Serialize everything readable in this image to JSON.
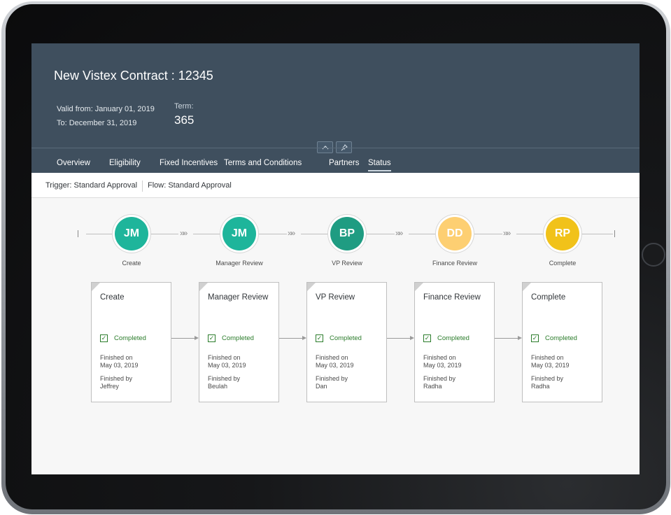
{
  "header": {
    "title": "New Vistex Contract : 12345",
    "valid_from": "Valid from: January 01, 2019",
    "valid_to": "To: December 31, 2019",
    "term_label": "Term:",
    "term_value": "365"
  },
  "tabs": [
    {
      "label": "Overview"
    },
    {
      "label": "Eligibility"
    },
    {
      "label": "Fixed Incentives"
    },
    {
      "label": "Terms and Conditions"
    },
    {
      "label": "Partners"
    },
    {
      "label": "Status",
      "active": true
    }
  ],
  "subbar": {
    "trigger": "Trigger: Standard Approval",
    "flow": "Flow: Standard Approval"
  },
  "flow": {
    "nodes": [
      {
        "initials": "JM",
        "label": "Create",
        "color": "#1eb59b"
      },
      {
        "initials": "JM",
        "label": "Manager Review",
        "color": "#1eb59b"
      },
      {
        "initials": "BP",
        "label": "VP Review",
        "color": "#1f9c82"
      },
      {
        "initials": "DD",
        "label": "Finance Review",
        "color": "#fdcf72"
      },
      {
        "initials": "RP",
        "label": "Complete",
        "color": "#f1c21a"
      }
    ],
    "connector_icon": "»»"
  },
  "cards": [
    {
      "title": "Create",
      "status": "Completed",
      "finished_on_label": "Finished on",
      "finished_on": "May 03, 2019",
      "finished_by_label": "Finished by",
      "finished_by": "Jeffrey"
    },
    {
      "title": "Manager Review",
      "status": "Completed",
      "finished_on_label": "Finished on",
      "finished_on": "May 03, 2019",
      "finished_by_label": "Finished by",
      "finished_by": "Beulah"
    },
    {
      "title": "VP Review",
      "status": "Completed",
      "finished_on_label": "Finished on",
      "finished_on": "May 03, 2019",
      "finished_by_label": "Finished by",
      "finished_by": "Dan"
    },
    {
      "title": "Finance Review",
      "status": "Completed",
      "finished_on_label": "Finished on",
      "finished_on": "May 03, 2019",
      "finished_by_label": "Finished by",
      "finished_by": "Radha"
    },
    {
      "title": "Complete",
      "status": "Completed",
      "finished_on_label": "Finished on",
      "finished_on": "May 03, 2019",
      "finished_by_label": "Finished by",
      "finished_by": "Radha"
    }
  ],
  "icons": {
    "collapse": "chevron-up-icon",
    "pin": "pin-icon",
    "check": "checkbox-checked-icon"
  }
}
